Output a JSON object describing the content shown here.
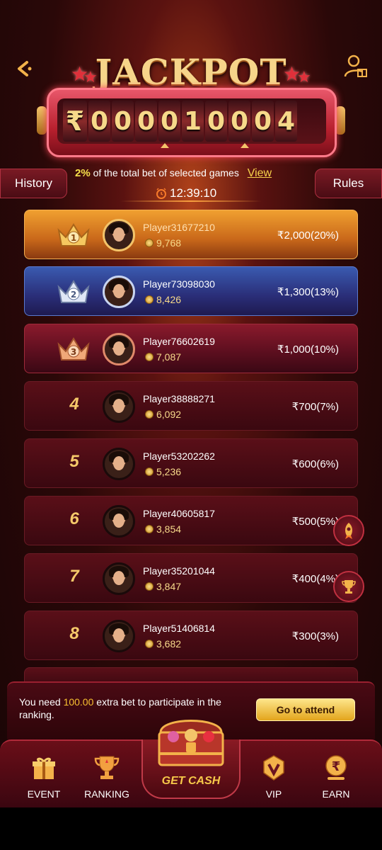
{
  "header": {
    "title": "JACKPOT",
    "counter_digits": [
      "₹",
      "0",
      "0",
      "0",
      "0",
      "1",
      "0",
      "0",
      "0",
      "4"
    ]
  },
  "tabs": {
    "history": "History",
    "rules": "Rules"
  },
  "info": {
    "percent": "2%",
    "text": "of the total bet of selected games",
    "view": "View",
    "timer": "12:39:10"
  },
  "ranking": [
    {
      "rank": "1",
      "name": "Player31677210",
      "coins": "9,768",
      "prize": "₹2,000(20%)"
    },
    {
      "rank": "2",
      "name": "Player73098030",
      "coins": "8,426",
      "prize": "₹1,300(13%)"
    },
    {
      "rank": "3",
      "name": "Player76602619",
      "coins": "7,087",
      "prize": "₹1,000(10%)"
    },
    {
      "rank": "4",
      "name": "Player38888271",
      "coins": "6,092",
      "prize": "₹700(7%)"
    },
    {
      "rank": "5",
      "name": "Player53202262",
      "coins": "5,236",
      "prize": "₹600(6%)"
    },
    {
      "rank": "6",
      "name": "Player40605817",
      "coins": "3,854",
      "prize": "₹500(5%)"
    },
    {
      "rank": "7",
      "name": "Player35201044",
      "coins": "3,847",
      "prize": "₹400(4%)"
    },
    {
      "rank": "8",
      "name": "Player51406814",
      "coins": "3,682",
      "prize": "₹300(3%)"
    }
  ],
  "participate": {
    "text_before": "You need ",
    "amount": "100.00",
    "text_after": " extra bet to participate in the ranking.",
    "button": "Go to attend"
  },
  "nav": {
    "event": "EVENT",
    "ranking": "RANKING",
    "get_cash": "GET CASH",
    "vip": "VIP",
    "earn": "EARN"
  },
  "colors": {
    "gold": "#f7d98a",
    "accent_red": "#b8202e",
    "rank1": "#f0a030",
    "rank2": "#3a5ab0",
    "rank3": "#8a1a2c"
  }
}
